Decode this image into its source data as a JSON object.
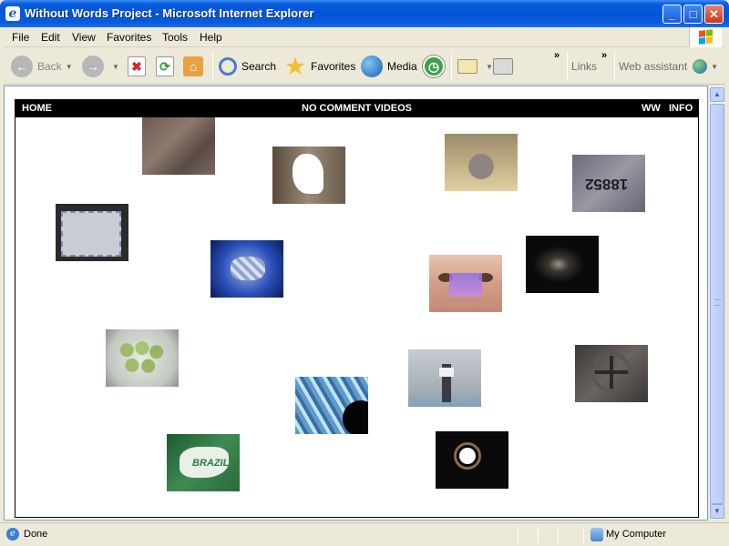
{
  "window": {
    "title": "Without Words Project - Microsoft Internet Explorer",
    "app_icon": "ie-logo-icon",
    "controls": [
      "minimize-icon",
      "maximize-icon",
      "close-icon"
    ]
  },
  "menu": {
    "items": [
      "File",
      "Edit",
      "View",
      "Favorites",
      "Tools",
      "Help"
    ]
  },
  "toolbar": {
    "back": "Back",
    "search": "Search",
    "favorites": "Favorites",
    "media": "Media",
    "links": "Links",
    "web_assistant": "Web assistant",
    "chevron": "»"
  },
  "page": {
    "nav": {
      "home": "HOME",
      "center": "NO COMMENT VIDEOS",
      "ww": "WW",
      "info": "INFO"
    },
    "thumbnails": [
      {
        "id": "roots",
        "color": "#6B5A52"
      },
      {
        "id": "bird-cutout",
        "color": "#8A7A6A"
      },
      {
        "id": "boot-stone",
        "color": "#B8A37A"
      },
      {
        "id": "number-18852",
        "color": "#7E7A86",
        "text": "18852"
      },
      {
        "id": "envelope",
        "color": "#BFC2C8"
      },
      {
        "id": "blue-pills",
        "color": "#1F3B9A"
      },
      {
        "id": "eyes",
        "color": "#D9A890"
      },
      {
        "id": "dark-light",
        "color": "#111111"
      },
      {
        "id": "green-candies",
        "color": "#B9C8A2"
      },
      {
        "id": "person-room",
        "color": "#A7B0B5"
      },
      {
        "id": "stone-cross",
        "color": "#4C4846"
      },
      {
        "id": "blue-water",
        "color": "#5E9BC8"
      },
      {
        "id": "brazil-map",
        "color": "#2E7A44",
        "text": "BRAZIL"
      },
      {
        "id": "dark-circle",
        "color": "#0A0A0A"
      }
    ]
  },
  "status": {
    "left": "Done",
    "zone": "My Computer"
  }
}
